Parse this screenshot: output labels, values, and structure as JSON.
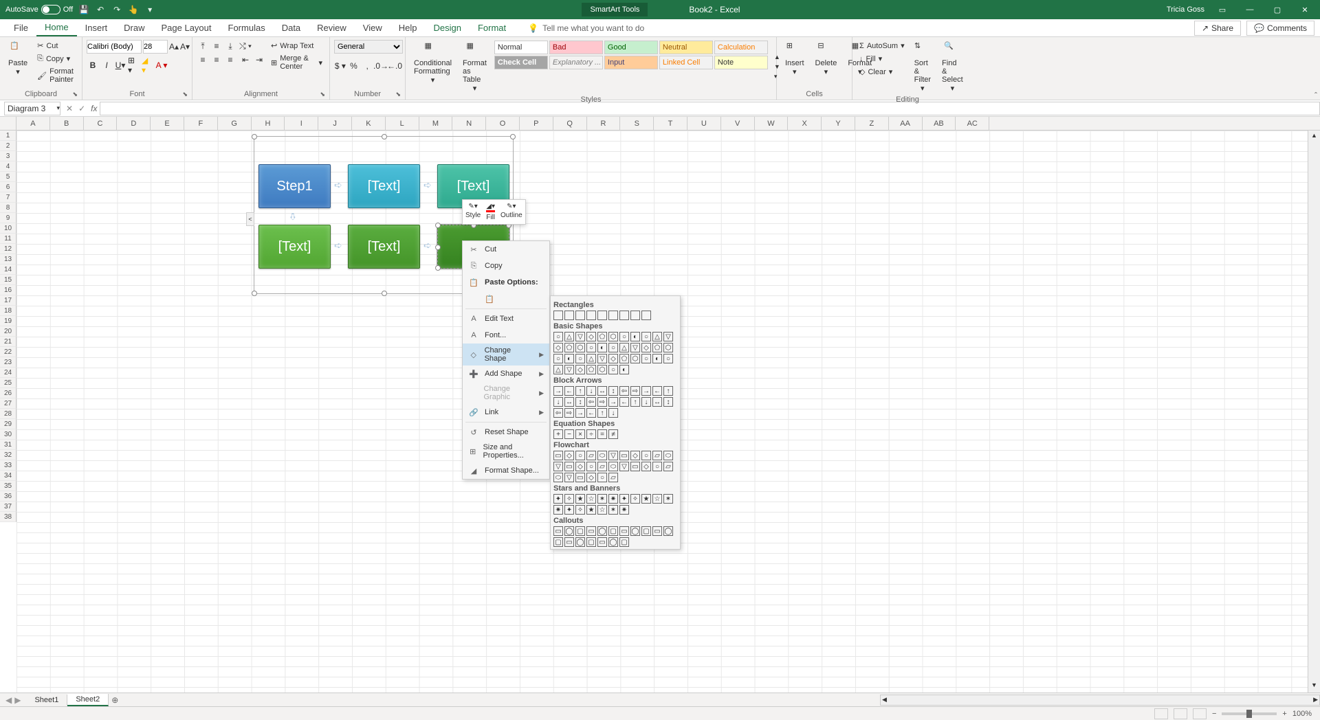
{
  "titlebar": {
    "autosave": "AutoSave",
    "autosave_state": "Off",
    "smartart_tools": "SmartArt Tools",
    "book_title": "Book2 - Excel",
    "user": "Tricia Goss"
  },
  "tabs": {
    "file": "File",
    "home": "Home",
    "insert": "Insert",
    "draw": "Draw",
    "page_layout": "Page Layout",
    "formulas": "Formulas",
    "data": "Data",
    "review": "Review",
    "view": "View",
    "help": "Help",
    "design": "Design",
    "format": "Format",
    "tell_me": "Tell me what you want to do",
    "share": "Share",
    "comments": "Comments"
  },
  "ribbon": {
    "clipboard": {
      "label": "Clipboard",
      "paste": "Paste",
      "cut": "Cut",
      "copy": "Copy",
      "format_painter": "Format Painter"
    },
    "font": {
      "label": "Font",
      "name": "Calibri (Body)",
      "size": "28"
    },
    "alignment": {
      "label": "Alignment",
      "wrap": "Wrap Text",
      "merge": "Merge & Center"
    },
    "number": {
      "label": "Number",
      "format": "General"
    },
    "styles": {
      "label": "Styles",
      "cond": "Conditional Formatting",
      "table": "Format as Table",
      "normal": "Normal",
      "bad": "Bad",
      "good": "Good",
      "neutral": "Neutral",
      "calc": "Calculation",
      "check": "Check Cell",
      "explan": "Explanatory ...",
      "input": "Input",
      "linked": "Linked Cell",
      "note": "Note"
    },
    "cells": {
      "label": "Cells",
      "insert": "Insert",
      "delete": "Delete",
      "format": "Format"
    },
    "editing": {
      "label": "Editing",
      "autosum": "AutoSum",
      "fill": "Fill",
      "clear": "Clear",
      "sort": "Sort & Filter",
      "find": "Find & Select"
    }
  },
  "formula_bar": {
    "name_box": "Diagram 3"
  },
  "columns": [
    "A",
    "B",
    "C",
    "D",
    "E",
    "F",
    "G",
    "H",
    "I",
    "J",
    "K",
    "L",
    "M",
    "N",
    "O",
    "P",
    "Q",
    "R",
    "S",
    "T",
    "U",
    "V",
    "W",
    "X",
    "Y",
    "Z",
    "AA",
    "AB",
    "AC"
  ],
  "smartart": {
    "boxes": [
      "Step1",
      "[Text]",
      "[Text]",
      "[Text]",
      "[Text]",
      ""
    ]
  },
  "mini_toolbar": {
    "style": "Style",
    "fill": "Fill",
    "outline": "Outline"
  },
  "context_menu": {
    "cut": "Cut",
    "copy": "Copy",
    "paste_options": "Paste Options:",
    "edit_text": "Edit Text",
    "font": "Font...",
    "change_shape": "Change Shape",
    "add_shape": "Add Shape",
    "change_graphic": "Change Graphic",
    "link": "Link",
    "reset": "Reset Shape",
    "size_props": "Size and Properties...",
    "format_shape": "Format Shape..."
  },
  "shape_gallery": {
    "rectangles": "Rectangles",
    "basic": "Basic Shapes",
    "arrows": "Block Arrows",
    "equation": "Equation Shapes",
    "flowchart": "Flowchart",
    "stars": "Stars and Banners",
    "callouts": "Callouts"
  },
  "sheets": {
    "sheet1": "Sheet1",
    "sheet2": "Sheet2"
  },
  "status": {
    "zoom": "100%"
  }
}
